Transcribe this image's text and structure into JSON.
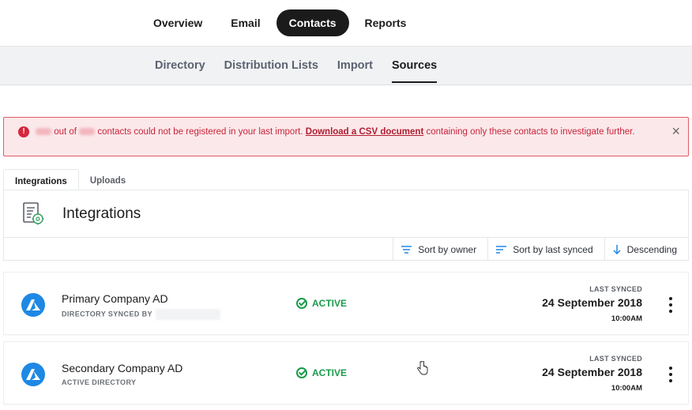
{
  "topnav": {
    "tabs": [
      {
        "label": "Overview",
        "active": false
      },
      {
        "label": "Email",
        "active": false
      },
      {
        "label": "Contacts",
        "active": true
      },
      {
        "label": "Reports",
        "active": false
      }
    ]
  },
  "subnav": {
    "tabs": [
      {
        "label": "Directory",
        "active": false
      },
      {
        "label": "Distribution Lists",
        "active": false
      },
      {
        "label": "Import",
        "active": false
      },
      {
        "label": "Sources",
        "active": true
      }
    ]
  },
  "alert": {
    "text_part1": "out of",
    "text_part2": "contacts could not be registered in your last import.",
    "link_label": "Download a CSV document",
    "text_part3": "containing only these contacts to investigate further.",
    "close_label": "×",
    "color": "#c8243a"
  },
  "page_tabs": [
    {
      "label": "Integrations",
      "active": true
    },
    {
      "label": "Uploads",
      "active": false
    }
  ],
  "panel": {
    "title": "Integrations",
    "icon": "document-settings-icon",
    "sort": {
      "owner_label": "Sort by owner",
      "last_synced_label": "Sort by last synced",
      "order_label": "Descending"
    }
  },
  "integrations": [
    {
      "name": "Primary Company AD",
      "subtitle": "DIRECTORY SYNCED BY",
      "status": "ACTIVE",
      "last_synced_label": "LAST SYNCED",
      "last_synced_date": "24 September 2018",
      "last_synced_time": "10:00AM",
      "icon": "azure-icon"
    },
    {
      "name": "Secondary Company AD",
      "subtitle": "ACTIVE DIRECTORY",
      "status": "ACTIVE",
      "last_synced_label": "LAST SYNCED",
      "last_synced_date": "24 September 2018",
      "last_synced_time": "10:00AM",
      "icon": "azure-icon"
    }
  ],
  "colors": {
    "active_status": "#1b9a4b",
    "azure_blue": "#1e88e5",
    "nav_active": "#1b1b1b"
  }
}
